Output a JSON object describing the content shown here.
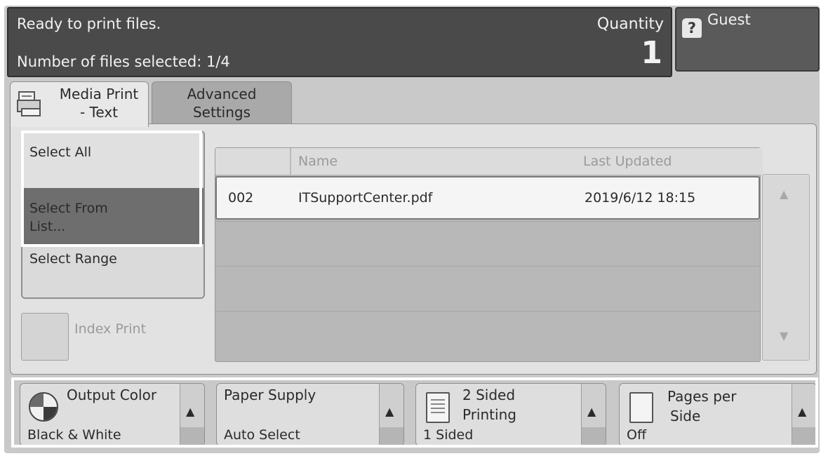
{
  "status": {
    "message": "Ready to print files.",
    "files_selected": "Number of files selected: 1/4",
    "quantity_label": "Quantity",
    "quantity_value": "1"
  },
  "user": {
    "label": "Guest",
    "icon": "guest-icon"
  },
  "tabs": [
    {
      "label_line1": "Media Print",
      "label_line2": "- Text",
      "icon": "printer-icon"
    },
    {
      "label_line1": "Advanced",
      "label_line2": "Settings"
    }
  ],
  "selection": {
    "select_all": "Select All",
    "select_from_list_line1": "Select From",
    "select_from_list_line2": "List...",
    "select_range": "Select Range",
    "index_print": "Index Print"
  },
  "file_table": {
    "columns": [
      "Name",
      "Last Updated"
    ],
    "rows": [
      {
        "number": "002",
        "name": "ITSupportCenter.pdf",
        "updated": "2019/6/12 18:15"
      }
    ]
  },
  "features": {
    "output_color": {
      "title": "Output Color",
      "value": "Black & White",
      "icon": "color-wheel-icon"
    },
    "paper_supply": {
      "title": "Paper Supply",
      "value": "Auto Select"
    },
    "two_sided": {
      "title_line1": "2 Sided",
      "title_line2": "Printing",
      "value": "1 Sided",
      "icon": "page-icon"
    },
    "pages_per_side": {
      "title_line1": "Pages per",
      "title_line2": "Side",
      "value": "Off",
      "icon": "page-icon"
    }
  },
  "glyphs": {
    "arrow_up": "▲",
    "arrow_down": "▼"
  }
}
